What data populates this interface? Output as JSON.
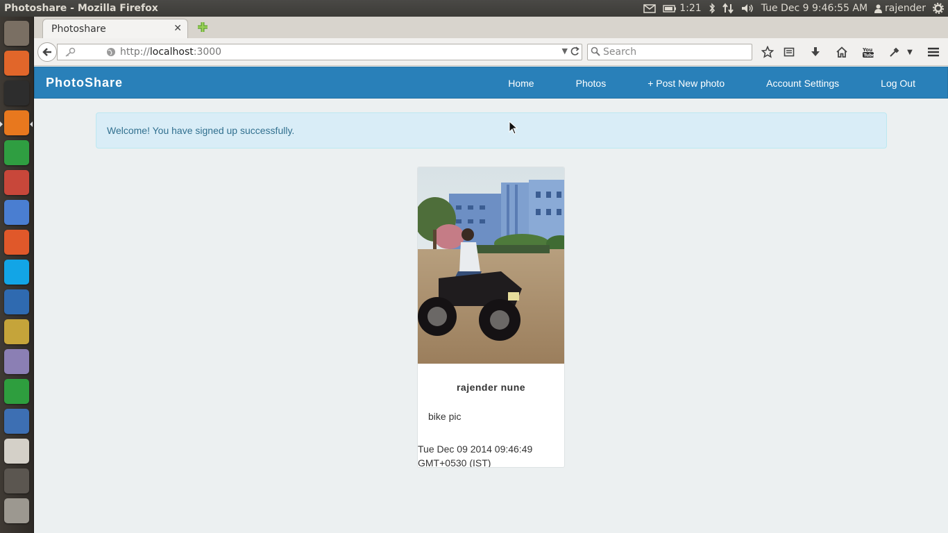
{
  "os": {
    "window_title": "Photoshare - Mozilla Firefox",
    "battery_time": "1:21",
    "datetime": "Tue Dec  9  9:46:55 AM",
    "user": "rajender"
  },
  "launcher": {
    "items": [
      {
        "name": "dash-home",
        "color": "#7a6f63"
      },
      {
        "name": "files",
        "color": "#e1662a"
      },
      {
        "name": "terminal",
        "color": "#2d2d2d"
      },
      {
        "name": "firefox",
        "color": "#e8781e"
      },
      {
        "name": "libreoffice-calc",
        "color": "#2f9e41"
      },
      {
        "name": "system-settings",
        "color": "#c8473a"
      },
      {
        "name": "chromium",
        "color": "#4a7ed1"
      },
      {
        "name": "software-center",
        "color": "#e0582a"
      },
      {
        "name": "skype",
        "color": "#12a5e6"
      },
      {
        "name": "libreoffice-writer",
        "color": "#2f6ab0"
      },
      {
        "name": "calculator",
        "color": "#c5a43a"
      },
      {
        "name": "webcam-cheese",
        "color": "#8b7fb4"
      },
      {
        "name": "recycle",
        "color": "#2e9e3e"
      },
      {
        "name": "pidgin",
        "color": "#3d6fb3"
      },
      {
        "name": "image-editor",
        "color": "#d4d0c8"
      },
      {
        "name": "window",
        "color": "#5b5650"
      },
      {
        "name": "drive",
        "color": "#9c9890"
      }
    ]
  },
  "browser": {
    "tab_title": "Photoshare",
    "url_scheme": "http://",
    "url_host": "localhost",
    "url_port": ":3000",
    "search_placeholder": "Search"
  },
  "site": {
    "brand": "PhotoShare",
    "nav": [
      "Home",
      "Photos",
      "+ Post New photo",
      "Account Settings",
      "Log Out"
    ],
    "alert": "Welcome! You have signed up successfully.",
    "accent_color": "#2980b9"
  },
  "photo_card": {
    "owner": "rajender nune",
    "caption": "bike pic",
    "date_line1": "Tue Dec 09 2014 09:46:49",
    "date_line2": "GMT+0530 (IST)"
  }
}
